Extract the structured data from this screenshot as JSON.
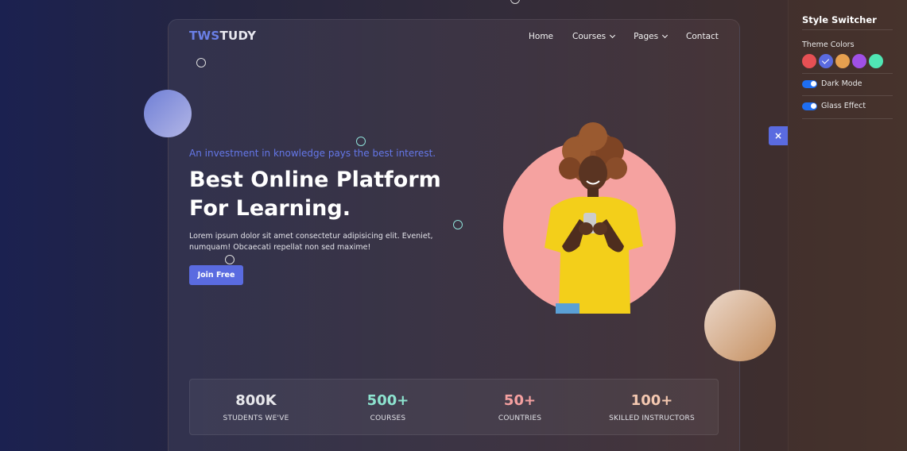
{
  "brand": {
    "part1": "TWS",
    "part2": "TUDY",
    "accent": "#6a7fe6"
  },
  "nav": {
    "home": "Home",
    "courses": "Courses",
    "pages": "Pages",
    "contact": "Contact",
    "dropdown_icon": "chevron-down-icon"
  },
  "hero": {
    "tagline": "An investment in knowledge pays the best interest.",
    "title_line1": "Best Online Platform",
    "title_line2": "For Learning.",
    "description": "Lorem ipsum dolor sit amet consectetur adipisicing elit. Eveniet, numquam! Obcaecati repellat non sed maxime!",
    "cta": "Join Free",
    "image_alt": "student-with-phone",
    "cta_color": "#5a6be0"
  },
  "stats": [
    {
      "value": "800K",
      "label": "STUDENTS WE'VE",
      "color": "#e8e8ec"
    },
    {
      "value": "500+",
      "label": "COURSES",
      "color": "#8de3cf"
    },
    {
      "value": "50+",
      "label": "COUNTRIES",
      "color": "#f5a0a0"
    },
    {
      "value": "100+",
      "label": "SKILLED INSTRUCTORS",
      "color": "#f4c8b0"
    }
  ],
  "style_switcher": {
    "title": "Style Switcher",
    "theme_colors_label": "Theme Colors",
    "colors": [
      "#e65054",
      "#5a6be0",
      "#e6a050",
      "#a050e6",
      "#50e6b4"
    ],
    "selected_color": "#5a6be0",
    "dark_mode_label": "Dark Mode",
    "dark_mode_on": true,
    "glass_effect_label": "Glass Effect",
    "glass_effect_on": true,
    "close_label": "×"
  }
}
